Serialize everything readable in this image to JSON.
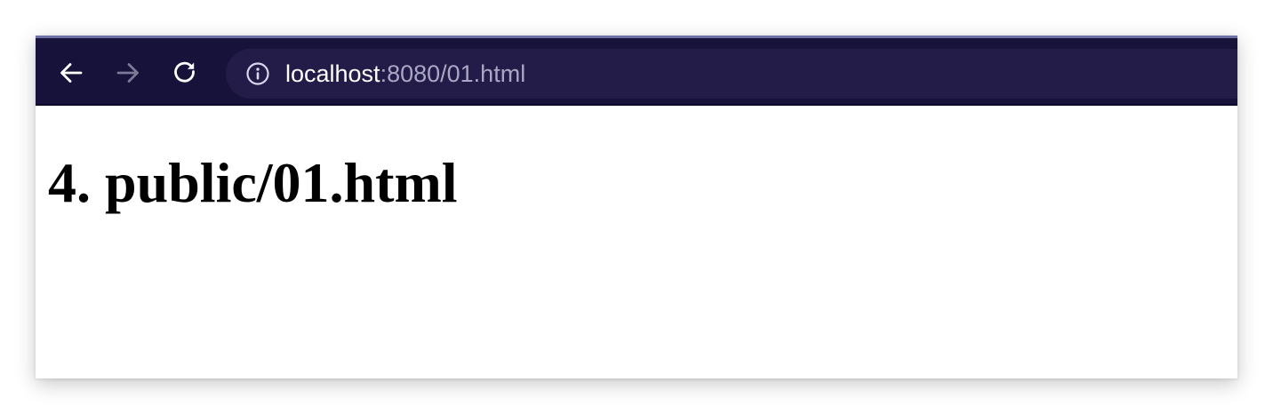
{
  "browser": {
    "toolbar": {
      "back_icon": "arrow-left-icon",
      "forward_icon": "arrow-right-icon",
      "reload_icon": "reload-icon",
      "forward_enabled": false
    },
    "address_bar": {
      "site_info_icon": "info-icon",
      "host": "localhost",
      "rest": ":8080/01.html"
    }
  },
  "page": {
    "heading": "4. public/01.html"
  },
  "colors": {
    "toolbar_bg": "#16123a",
    "urlbar_bg": "#231c48",
    "url_host": "#ffffff",
    "url_rest": "#a9a7c4"
  }
}
